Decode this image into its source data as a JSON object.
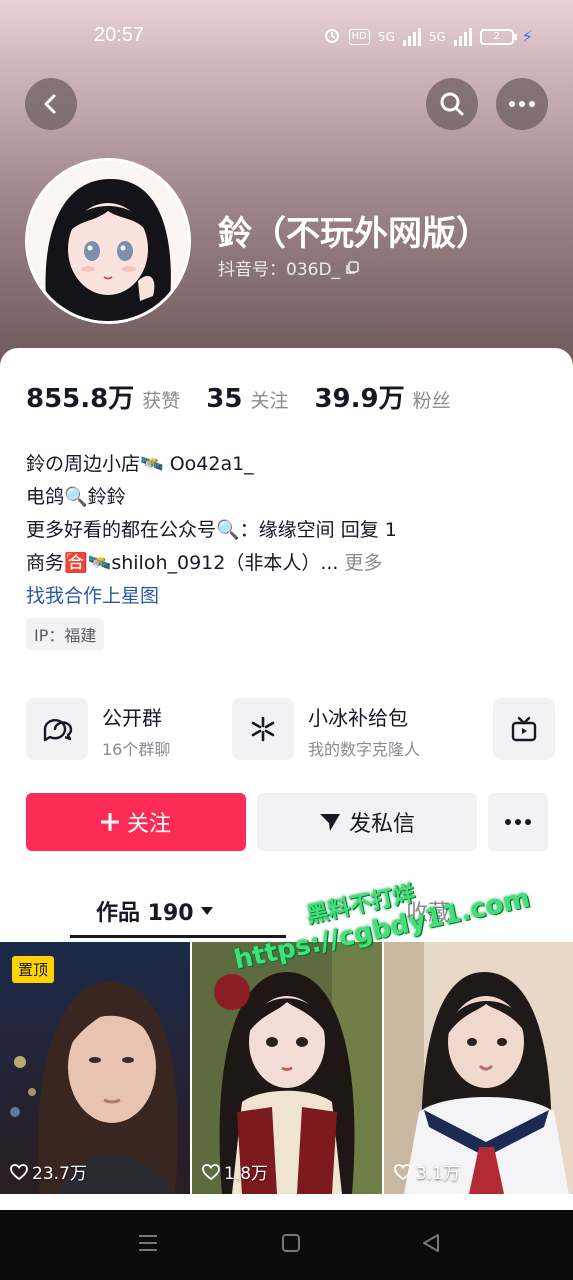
{
  "status_bar": {
    "time": "20:57",
    "battery": "2",
    "hd_label": "HD",
    "net1": "5G",
    "net2": "5G"
  },
  "profile": {
    "username": "鈴（不玩外网版）",
    "douyin_id": "抖音号：036D_",
    "stats": [
      {
        "value": "855.8万",
        "label": "获赞"
      },
      {
        "value": "35",
        "label": "关注"
      },
      {
        "value": "39.9万",
        "label": "粉丝"
      }
    ],
    "bio": {
      "line1": "鈴の周边小店🛰️  Oo42a1_",
      "line2": "电鸽🔍鈴鈴",
      "line3": "更多好看的都在公众号🔍：缘缘空间 回复 1",
      "line4": "商务🈴🛰️shiloh_0912（非本人）...",
      "more": "更多",
      "starmap_link": "找我合作上星图"
    },
    "ip_location": "IP：福建"
  },
  "features": [
    {
      "title": "公开群",
      "subtitle": "16个群聊",
      "icon": "group-chat-icon"
    },
    {
      "title": "小冰补给包",
      "subtitle": "我的数字克隆人",
      "icon": "xiaobing-icon"
    },
    {
      "title": "",
      "subtitle": "",
      "icon": "tv-icon"
    }
  ],
  "actions": {
    "follow": "关注",
    "message": "发私信"
  },
  "tabs": {
    "works": "作品 190",
    "favorites": "收藏"
  },
  "videos": [
    {
      "likes": "23.7万",
      "pinned": "置顶"
    },
    {
      "likes": "1.8万"
    },
    {
      "likes": "3.1万"
    }
  ],
  "watermark": {
    "line1": "黑料不打烊",
    "line2": "https://cgbdy11.com"
  },
  "colors": {
    "accent": "#fe2c55",
    "link": "#2b5aa4",
    "pin": "#fdd300",
    "watermark": "#43e07a"
  }
}
